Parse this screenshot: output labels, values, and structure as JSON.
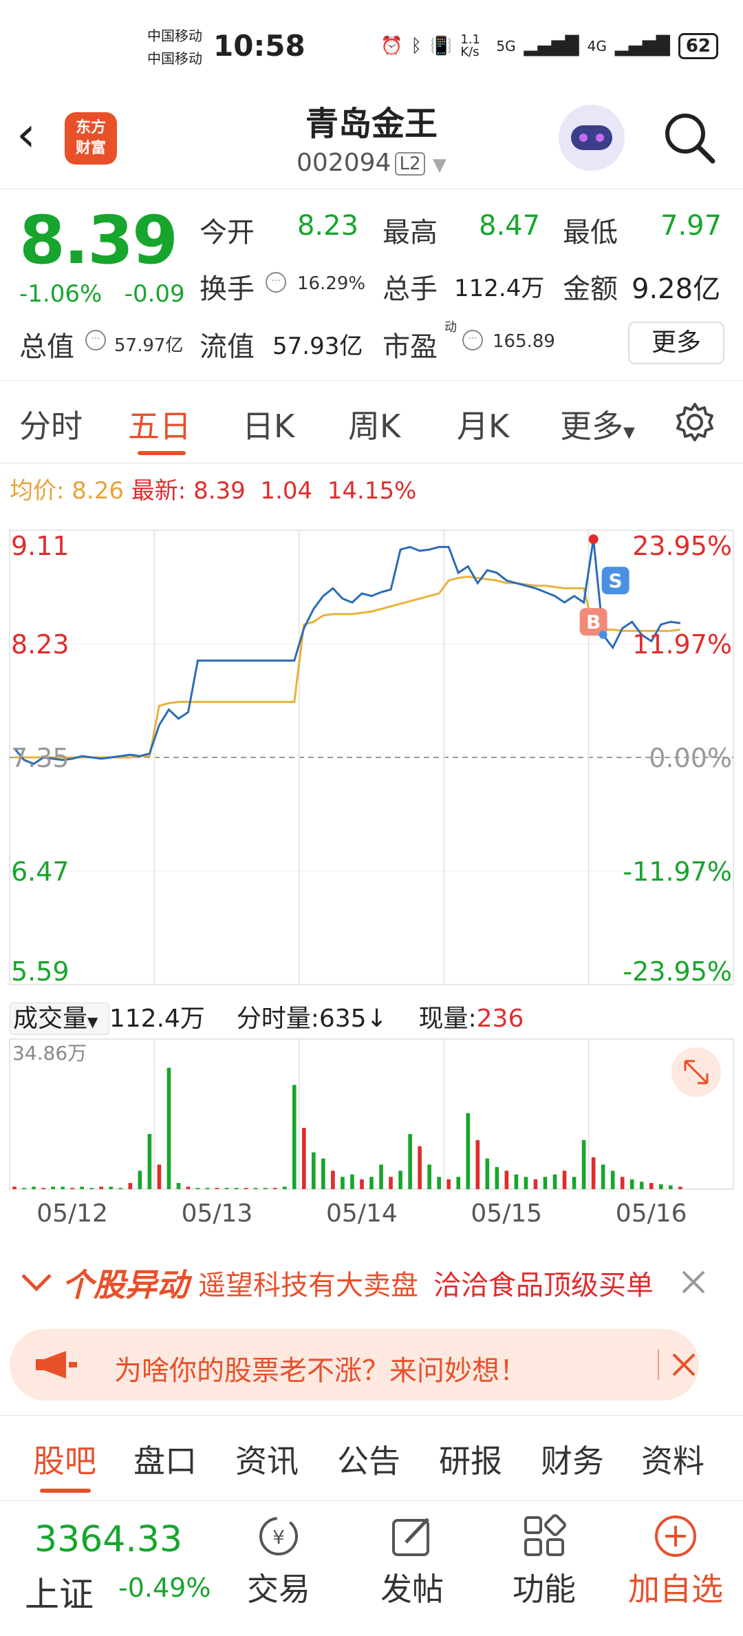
{
  "status": {
    "carrier1": "中国移动",
    "carrier2": "中国移动",
    "time": "10:58",
    "net_speed": "1.1 K/s",
    "signal1": "5G",
    "signal2": "4G",
    "battery": "62"
  },
  "header": {
    "logo_text_line1": "东方",
    "logo_text_line2": "财富",
    "title": "青岛金王",
    "code": "002094",
    "level": "L2"
  },
  "quote": {
    "price": "8.39",
    "change_pct": "-1.06%",
    "change": "-0.09",
    "open_label": "今开",
    "open": "8.23",
    "high_label": "最高",
    "high": "8.47",
    "low_label": "最低",
    "low": "7.97",
    "turnover_label": "换手",
    "turnover": "16.29%",
    "volume_label": "总手",
    "volume": "112.4万",
    "amount_label": "金额",
    "amount": "9.28亿",
    "mcap_label": "总值",
    "mcap": "57.97亿",
    "float_label": "流值",
    "float": "57.93亿",
    "pe_label": "市盈",
    "pe_sup": "动",
    "pe": "165.89",
    "more": "更多"
  },
  "tabs": [
    {
      "label": "分时"
    },
    {
      "label": "五日"
    },
    {
      "label": "日K"
    },
    {
      "label": "周K"
    },
    {
      "label": "月K"
    },
    {
      "label": "更多"
    }
  ],
  "avg_line": {
    "avg_label": "均价:",
    "avg": "8.26",
    "latest_label": "最新:",
    "latest": "8.39",
    "chg": "1.04",
    "pct": "14.15%"
  },
  "colors": {
    "up": "#e02c2c",
    "down": "#17a52d",
    "accent": "#e8502a",
    "price_line": "#2a6cb8",
    "avg_line": "#e8b23a"
  },
  "chart_data": {
    "type": "line",
    "days": [
      "05/12",
      "05/13",
      "05/14",
      "05/15",
      "05/16"
    ],
    "y_ticks_left": [
      "9.11",
      "8.23",
      "7.35",
      "6.47",
      "5.59"
    ],
    "y_ticks_right": [
      "23.95%",
      "11.97%",
      "0.00%",
      "-11.97%",
      "-23.95%"
    ],
    "ylim": [
      5.59,
      9.11
    ],
    "prev_close": 7.35,
    "series": [
      {
        "values": [
          7.42,
          7.33,
          7.3,
          7.35,
          7.34,
          7.33,
          7.34,
          7.36,
          7.35,
          7.34,
          7.35,
          7.36,
          7.37,
          7.36,
          7.38,
          7.6,
          7.72,
          7.65,
          7.7,
          8.1,
          8.1,
          8.1,
          8.1,
          8.1,
          8.1,
          8.1,
          8.1,
          8.1,
          8.1,
          8.1,
          8.35,
          8.5,
          8.6,
          8.66,
          8.58,
          8.55,
          8.62,
          8.6,
          8.63,
          8.65,
          8.96,
          8.98,
          8.95,
          8.96,
          8.98,
          8.98,
          8.78,
          8.83,
          8.7,
          8.8,
          8.78,
          8.72,
          8.7,
          8.68,
          8.66,
          8.63,
          8.6,
          8.55,
          8.6,
          8.55,
          9.04,
          8.3,
          8.2,
          8.35,
          8.4,
          8.3,
          8.25,
          8.38,
          8.4,
          8.39
        ]
      },
      {
        "values": [
          7.35,
          7.35,
          7.35,
          7.35,
          7.35,
          7.35,
          7.35,
          7.35,
          7.35,
          7.35,
          7.35,
          7.35,
          7.35,
          7.36,
          7.36,
          7.75,
          7.77,
          7.78,
          7.78,
          7.78,
          7.78,
          7.78,
          7.78,
          7.78,
          7.78,
          7.78,
          7.78,
          7.78,
          7.78,
          7.78,
          8.38,
          8.4,
          8.45,
          8.46,
          8.46,
          8.46,
          8.47,
          8.48,
          8.5,
          8.52,
          8.54,
          8.56,
          8.58,
          8.6,
          8.62,
          8.72,
          8.74,
          8.75,
          8.74,
          8.73,
          8.72,
          8.7,
          8.7,
          8.69,
          8.68,
          8.68,
          8.67,
          8.66,
          8.66,
          8.66,
          8.35,
          8.34,
          8.34,
          8.33,
          8.33,
          8.33,
          8.33,
          8.33,
          8.33,
          8.34
        ]
      }
    ],
    "markers": [
      "S",
      "B"
    ]
  },
  "volume": {
    "label": "成交量",
    "total": "112.4万",
    "tick_label": "分时量:635↓",
    "now_label": "现量:",
    "now": "236",
    "max": "34.86万",
    "bars": [
      0.02,
      0.01,
      0.02,
      0.01,
      0.02,
      0.02,
      0.01,
      0.02,
      0.01,
      0.02,
      0.02,
      0.01,
      0.05,
      0.15,
      0.45,
      0.2,
      0.99,
      0.05,
      0.02,
      0.01,
      0.01,
      0.01,
      0.01,
      0.01,
      0.01,
      0.01,
      0.01,
      0.01,
      0.02,
      0.85,
      0.5,
      0.3,
      0.25,
      0.15,
      0.1,
      0.12,
      0.08,
      0.1,
      0.2,
      0.1,
      0.15,
      0.45,
      0.35,
      0.2,
      0.1,
      0.08,
      0.1,
      0.62,
      0.4,
      0.25,
      0.18,
      0.15,
      0.12,
      0.1,
      0.08,
      0.1,
      0.12,
      0.15,
      0.1,
      0.4,
      0.26,
      0.2,
      0.15,
      0.1,
      0.08,
      0.06,
      0.05,
      0.04,
      0.03,
      0.02
    ]
  },
  "ticker": {
    "tag": "个股异动",
    "news1": "遥望科技有大卖盘",
    "news2": "洽洽食品顶级买单"
  },
  "promo": {
    "text": "为啥你的股票老不涨？来问妙想！"
  },
  "subtabs": [
    {
      "label": "股吧"
    },
    {
      "label": "盘口"
    },
    {
      "label": "资讯"
    },
    {
      "label": "公告"
    },
    {
      "label": "研报"
    },
    {
      "label": "财务"
    },
    {
      "label": "资料"
    }
  ],
  "bottom": {
    "index_value": "3364.33",
    "index_name": "上证",
    "index_change": "-0.49%",
    "trade": "交易",
    "post": "发帖",
    "func": "功能",
    "add": "加自选"
  }
}
